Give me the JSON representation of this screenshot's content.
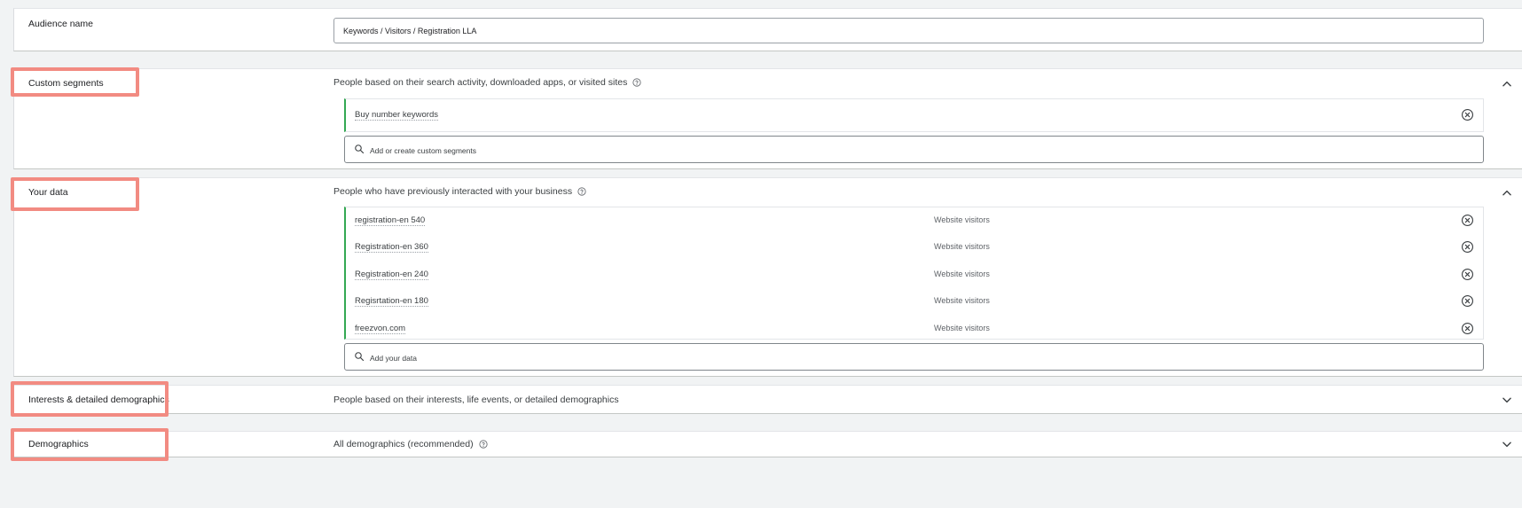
{
  "audience_name": {
    "label": "Audience name",
    "value": "Keywords / Visitors / Registration LLA"
  },
  "custom_segments": {
    "label": "Custom segments",
    "description": "People based on their search activity, downloaded apps, or visited sites",
    "expanded": true,
    "items": [
      {
        "name": "Buy number keywords"
      }
    ],
    "search_placeholder": "Add or create custom segments"
  },
  "your_data": {
    "label": "Your data",
    "description": "People who have previously interacted with your business",
    "expanded": true,
    "items": [
      {
        "name": "registration-en 540",
        "type": "Website visitors"
      },
      {
        "name": "Registration-en 360",
        "type": "Website visitors"
      },
      {
        "name": "Registration-en 240",
        "type": "Website visitors"
      },
      {
        "name": "Regisrtation-en 180",
        "type": "Website visitors"
      },
      {
        "name": "freezvon.com",
        "type": "Website visitors"
      }
    ],
    "search_placeholder": "Add your data"
  },
  "interests": {
    "label": "Interests & detailed demographics",
    "description": "People based on their interests, life events, or detailed demographics",
    "expanded": false
  },
  "demographics": {
    "label": "Demographics",
    "description": "All demographics (recommended)",
    "expanded": false
  },
  "colors": {
    "highlight": "#f28b82",
    "list_accent": "#34a853",
    "page_background": "#f1f3f4"
  },
  "icons": [
    "help-icon",
    "chevron-up-icon",
    "chevron-down-icon",
    "close-circle-icon",
    "search-icon"
  ]
}
